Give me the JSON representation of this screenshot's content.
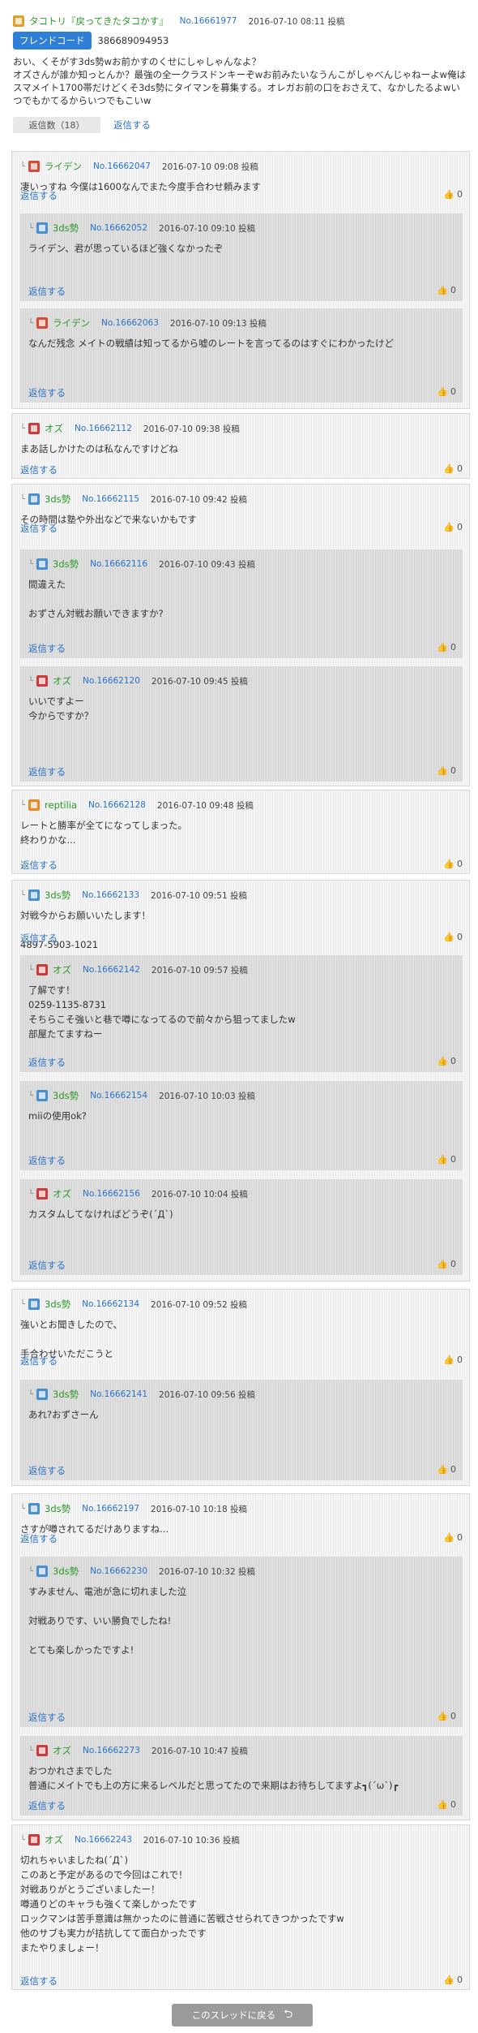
{
  "top": {
    "user": "タコトリ『戻ってきたタコかす』",
    "no": "No.16661977",
    "date": "2016-07-10 08:11 投稿",
    "friend_label": "フレンドコード",
    "friend_code": "386689094953",
    "body": "おい、くそがす3ds勢wお前かすのくせにしゃしゃんなよ？\nオズさんが誰か知っとんか？最強の全一クラスドンキーぞwお前みたいなうんこがしゃべんじゃねーよw俺はスマメイト1700帯だけどくそ3ds勢にタイマンを募集する。オレガお前の口をおさえて、なかしたるよwいつでもかてるからいつでもこいw",
    "reply_count": "返信数（18）",
    "reply_label": "返信する"
  },
  "labels": {
    "reply": "返信する",
    "back": "このスレッドに戻る",
    "tree": "└"
  },
  "threads": [
    {
      "post": {
        "user": "ライデン",
        "no": "No.16662047",
        "date": "2016-07-10 09:08 投稿",
        "body": "凄いっすね 今僕は1600なんでまた今度手合わせ頼みます",
        "likes": "0"
      },
      "children": [
        {
          "user": "3ds勢",
          "no": "No.16662052",
          "date": "2016-07-10 09:10 投稿",
          "body": "ライデン、君が思っているほど強くなかったぞ",
          "likes": "0"
        },
        {
          "user": "ライデン",
          "no": "No.16662063",
          "date": "2016-07-10 09:13 投稿",
          "body": "なんだ残念 メイトの戦績は知ってるから嘘のレートを言ってるのはすぐにわかったけど",
          "likes": "0"
        }
      ]
    },
    {
      "post": {
        "user": "オズ",
        "no": "No.16662112",
        "date": "2016-07-10 09:38 投稿",
        "body": "まあ話しかけたのは私なんですけどね",
        "likes": "0"
      },
      "children": []
    },
    {
      "post": {
        "user": "3ds勢",
        "no": "No.16662115",
        "date": "2016-07-10 09:42 投稿",
        "body": "その時間は塾や外出などで来ないかもです",
        "likes": "0"
      },
      "children": [
        {
          "user": "3ds勢",
          "no": "No.16662116",
          "date": "2016-07-10 09:43 投稿",
          "body": "間違えた\n\nおずさん対戦お願いできますか?",
          "likes": "0"
        },
        {
          "user": "オズ",
          "no": "No.16662120",
          "date": "2016-07-10 09:45 投稿",
          "body": "いいですよー\n今からですか？",
          "likes": "0"
        }
      ]
    },
    {
      "post": {
        "user": "reptilia",
        "no": "No.16662128",
        "date": "2016-07-10 09:48 投稿",
        "body": "レートと勝率が全てになってしまった。\n終わりかな...",
        "likes": "0"
      },
      "children": []
    },
    {
      "post": {
        "user": "3ds勢",
        "no": "No.16662133",
        "date": "2016-07-10 09:51 投稿",
        "body": "対戦今からお願いいたします！\n\n4897-5903-1021",
        "likes": "0"
      },
      "children": [
        {
          "user": "オズ",
          "no": "No.16662142",
          "date": "2016-07-10 09:57 投稿",
          "body": "了解です！\n0259-1135-8731\nそちらこそ強いと巷で噂になってるので前々から狙ってましたw\n部屋たてますねー",
          "likes": "0"
        },
        {
          "user": "3ds勢",
          "no": "No.16662154",
          "date": "2016-07-10 10:03 投稿",
          "body": "miiの使用ok?",
          "likes": "0"
        },
        {
          "user": "オズ",
          "no": "No.16662156",
          "date": "2016-07-10 10:04 投稿",
          "body": "カスタムしてなければどうぞ(´Д`)",
          "likes": "0"
        }
      ]
    },
    {
      "post": {
        "user": "3ds勢",
        "no": "No.16662134",
        "date": "2016-07-10 09:52 投稿",
        "body": "強いとお聞きしたので、\n\n手合わせいただこうと",
        "likes": "0"
      },
      "children": [
        {
          "user": "3ds勢",
          "no": "No.16662141",
          "date": "2016-07-10 09:56 投稿",
          "body": "あれ?おずさーん",
          "likes": "0"
        }
      ]
    },
    {
      "post": {
        "user": "3ds勢",
        "no": "No.16662197",
        "date": "2016-07-10 10:18 投稿",
        "body": "さすが噂されてるだけありますね...",
        "likes": "0"
      },
      "children": [
        {
          "user": "3ds勢",
          "no": "No.16662230",
          "date": "2016-07-10 10:32 投稿",
          "body": "すみません、電池が急に切れました泣\n\n対戦ありです、いい勝負でしたね!\n\nとても楽しかったですよ!",
          "likes": "0"
        },
        {
          "user": "オズ",
          "no": "No.16662273",
          "date": "2016-07-10 10:47 投稿",
          "body": "おつかれさまでした\n普通にメイトでも上の方に来るレベルだと思ってたので来期はお待ちしてますよ┓(´ω`)┏",
          "likes": "0"
        }
      ]
    },
    {
      "post": {
        "user": "オズ",
        "no": "No.16662243",
        "date": "2016-07-10 10:36 投稿",
        "body": "切れちゃいましたね(´Д`)\nこのあと予定があるので今回はこれで！\n対戦ありがとうございましたー！\n噂通りどのキャラも強くて楽しかったです\nロックマンは苦手意識は無かったのに普通に苦戦させられてきつかったですw\n他のサブも実力が拮抗してて面白かったです\nまたやりましょー！",
        "likes": "0"
      },
      "children": []
    }
  ]
}
